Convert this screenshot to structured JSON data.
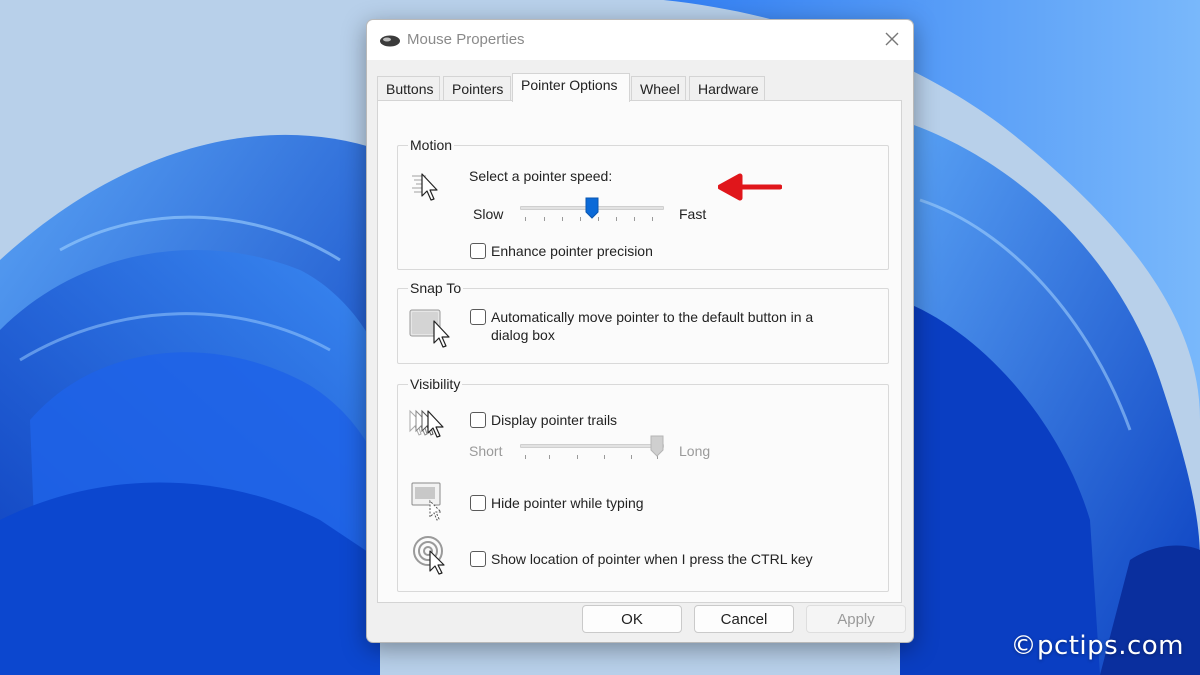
{
  "window": {
    "title": "Mouse Properties",
    "close_icon": "close-icon",
    "app_icon": "mouse-icon"
  },
  "tabs": [
    {
      "label": "Buttons",
      "active": false
    },
    {
      "label": "Pointers",
      "active": false
    },
    {
      "label": "Pointer Options",
      "active": true
    },
    {
      "label": "Wheel",
      "active": false
    },
    {
      "label": "Hardware",
      "active": false
    }
  ],
  "motion": {
    "group_label": "Motion",
    "speed_label": "Select a pointer speed:",
    "slow_label": "Slow",
    "fast_label": "Fast",
    "speed_level_fraction": 0.5,
    "enhance_precision_label": "Enhance pointer precision",
    "enhance_precision_checked": false,
    "icon": "pointer-speed-icon"
  },
  "snap_to": {
    "group_label": "Snap To",
    "auto_move_label_line1": "Automatically move pointer to the default button in a",
    "auto_move_label_line2": "dialog box",
    "auto_move_checked": false,
    "icon": "snap-to-icon"
  },
  "visibility": {
    "group_label": "Visibility",
    "trails_label": "Display pointer trails",
    "trails_checked": false,
    "short_label": "Short",
    "long_label": "Long",
    "trail_length_fraction": 1.0,
    "trails_slider_enabled": false,
    "hide_typing_label": "Hide pointer while typing",
    "hide_typing_checked": false,
    "show_location_label": "Show location of pointer when I press the CTRL key",
    "show_location_checked": false
  },
  "buttons": {
    "ok": "OK",
    "cancel": "Cancel",
    "apply": "Apply",
    "apply_enabled": false
  },
  "annotation": {
    "arrow_color": "#e0161b"
  },
  "colors": {
    "accent": "#0b6ad8",
    "wallpaper_blue": "#1759e6"
  },
  "watermark": "©pctips.com"
}
